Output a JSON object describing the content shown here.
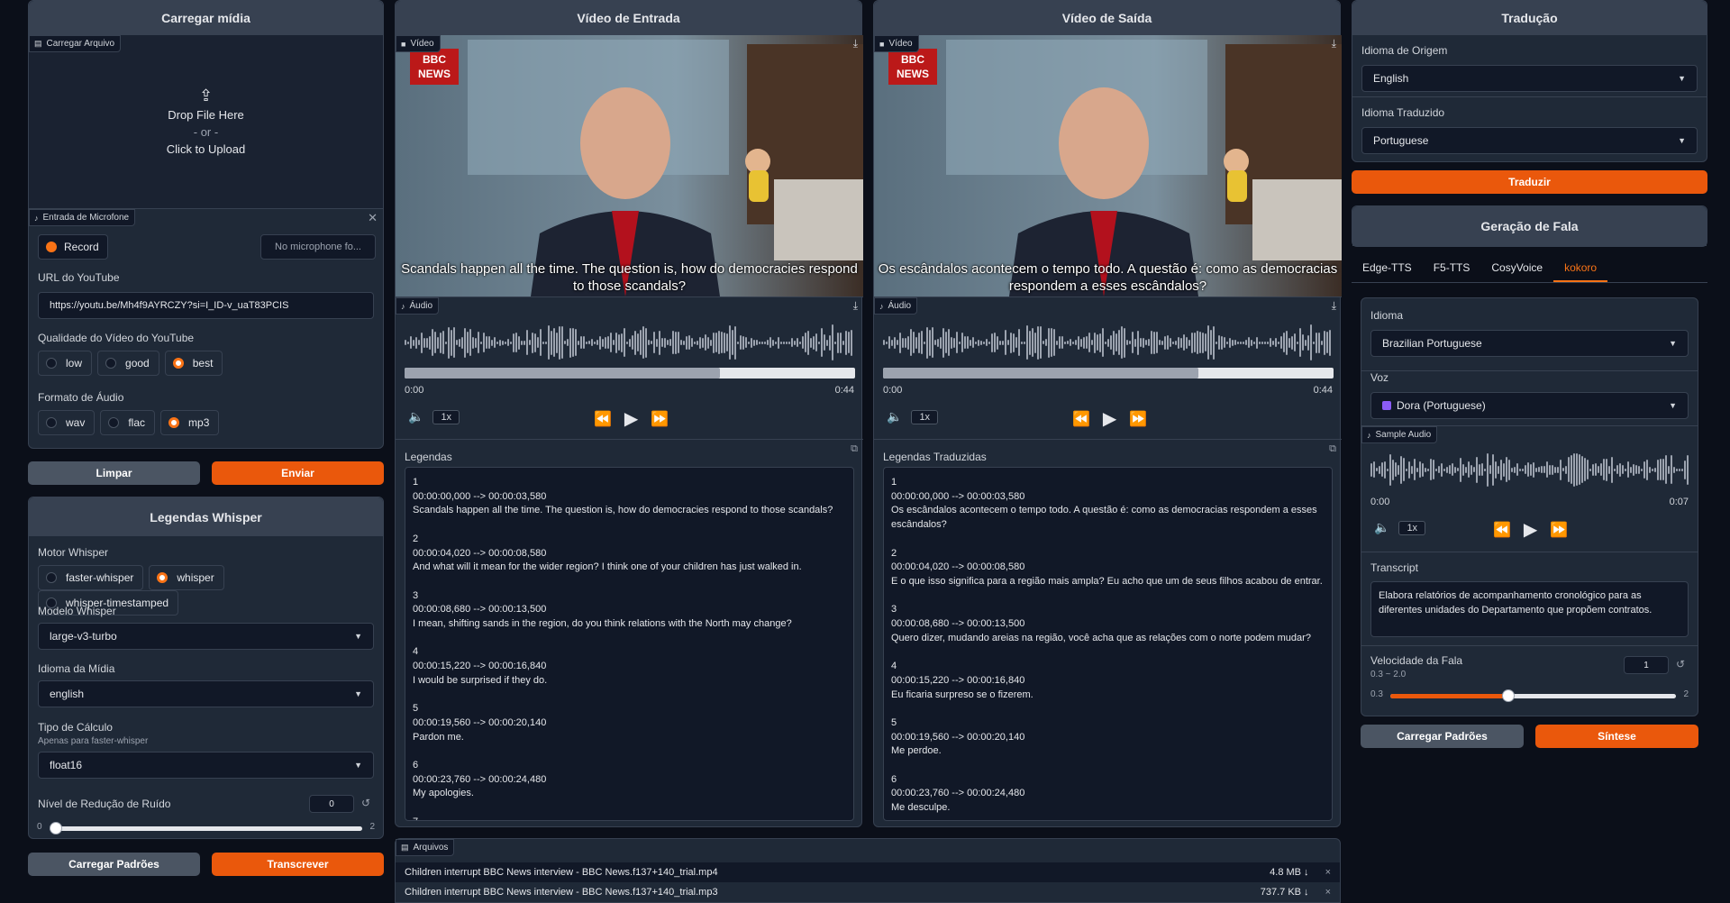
{
  "upload_panel": {
    "title": "Carregar mídia",
    "file_tag": "Carregar Arquivo",
    "drop": "Drop File Here",
    "or": "- or -",
    "click": "Click to Upload",
    "mic_tag": "Entrada de Microfone",
    "record": "Record",
    "mic_status": "No microphone fo...",
    "youtube_label": "URL do YouTube",
    "youtube_url": "https://youtu.be/Mh4f9AYRCZY?si=I_ID-v_uaT83PCIS",
    "quality_label": "Qualidade do Vídeo do YouTube",
    "quality_options": [
      "low",
      "good",
      "best"
    ],
    "quality_selected": "best",
    "format_label": "Formato de Áudio",
    "format_options": [
      "wav",
      "flac",
      "mp3"
    ],
    "format_selected": "mp3",
    "clear_button": "Limpar",
    "submit_button": "Enviar"
  },
  "whisper_panel": {
    "title": "Legendas Whisper",
    "engine_label": "Motor Whisper",
    "engine_options": [
      "faster-whisper",
      "whisper",
      "whisper-timestamped"
    ],
    "engine_selected": "whisper",
    "model_label": "Modelo Whisper",
    "model_value": "large-v3-turbo",
    "lang_label": "Idioma da Mídia",
    "lang_value": "english",
    "compute_label": "Tipo de Cálculo",
    "compute_sub": "Apenas para faster-whisper",
    "compute_value": "float16",
    "noise_label": "Nível de Redução de Ruído",
    "noise_value": "0",
    "noise_min": "0",
    "noise_max": "2",
    "noise_fraction": 0.0,
    "defaults_button": "Carregar Padrões",
    "transcribe_button": "Transcrever"
  },
  "input_video": {
    "title": "Vídeo de Entrada",
    "video_tag": "Vídeo",
    "logo": "BBC NEWS",
    "subtitle": "Scandals happen all the time. The question is, how do democracies respond to those scandals?",
    "audio_tag": "Áudio",
    "time_start": "0:00",
    "time_end": "0:44",
    "speed": "1x",
    "progress": 0.7,
    "subs_label": "Legendas",
    "subs_text": "1\n00:00:00,000 --> 00:00:03,580\nScandals happen all the time. The question is, how do democracies respond to those scandals?\n\n2\n00:00:04,020 --> 00:00:08,580\nAnd what will it mean for the wider region? I think one of your children has just walked in.\n\n3\n00:00:08,680 --> 00:00:13,500\nI mean, shifting sands in the region, do you think relations with the North may change?\n\n4\n00:00:15,220 --> 00:00:16,840\nI would be surprised if they do.\n\n5\n00:00:19,560 --> 00:00:20,140\nPardon me.\n\n6\n00:00:23,760 --> 00:00:24,480\nMy apologies.\n\n7"
  },
  "output_video": {
    "title": "Vídeo de Saída",
    "video_tag": "Vídeo",
    "logo": "BBC NEWS",
    "subtitle": "Os escândalos acontecem o tempo todo. A questão é: como as democracias respondem a esses escândalos?",
    "audio_tag": "Áudio",
    "time_start": "0:00",
    "time_end": "0:44",
    "speed": "1x",
    "progress": 0.7,
    "subs_label": "Legendas Traduzidas",
    "subs_text": "1\n00:00:00,000 --> 00:00:03,580\nOs escândalos acontecem o tempo todo. A questão é: como as democracias respondem a esses escândalos?\n\n2\n00:00:04,020 --> 00:00:08,580\nE o que isso significa para a região mais ampla? Eu acho que um de seus filhos acabou de entrar.\n\n3\n00:00:08,680 --> 00:00:13,500\nQuero dizer, mudando areias na região, você acha que as relações com o norte podem mudar?\n\n4\n00:00:15,220 --> 00:00:16,840\nEu ficaria surpreso se o fizerem.\n\n5\n00:00:19,560 --> 00:00:20,140\nMe perdoe.\n\n6\n00:00:23,760 --> 00:00:24,480\nMe desculpe."
  },
  "files": {
    "tag": "Arquivos",
    "items": [
      {
        "name": "Children interrupt BBC News interview - BBC News.f137+140_trial.mp4",
        "size": "4.8 MB ↓"
      },
      {
        "name": "Children interrupt BBC News interview - BBC News.f137+140_trial.mp3",
        "size": "737.7 KB ↓"
      }
    ]
  },
  "translate_panel": {
    "title": "Tradução",
    "source_label": "Idioma de Origem",
    "source_value": "English",
    "target_label": "Idioma Traduzido",
    "target_value": "Portuguese",
    "translate_button": "Traduzir"
  },
  "tts_panel": {
    "title": "Geração de Fala",
    "tabs": [
      "Edge-TTS",
      "F5-TTS",
      "CosyVoice",
      "kokoro"
    ],
    "active_tab": "kokoro",
    "lang_label": "Idioma",
    "lang_value": "Brazilian Portuguese",
    "voice_label": "Voz",
    "voice_value": "Dora (Portuguese)",
    "sample_tag": "Sample Audio",
    "time_start": "0:00",
    "time_end": "0:07",
    "speed": "1x",
    "transcript_label": "Transcript",
    "transcript_text": "Elabora relatórios de acompanhamento cronológico para as diferentes unidades do Departamento que propõem contratos.",
    "rate_label": "Velocidade da Fala",
    "rate_sub": "0.3 ~ 2.0",
    "rate_value": "1",
    "rate_min": "0.3",
    "rate_max": "2",
    "rate_fraction": 0.41,
    "defaults_button": "Carregar Padrões",
    "synth_button": "Síntese"
  },
  "colors": {
    "accent": "#ea580c",
    "panel": "#1f2937",
    "background": "#0b0f19"
  },
  "icons": [
    "upload-icon",
    "file-icon",
    "mic-icon",
    "video-icon",
    "download-icon",
    "volume-icon",
    "rewind-icon",
    "play-icon",
    "forward-icon",
    "copy-icon",
    "close-icon",
    "reset-icon",
    "caret-down-icon"
  ]
}
